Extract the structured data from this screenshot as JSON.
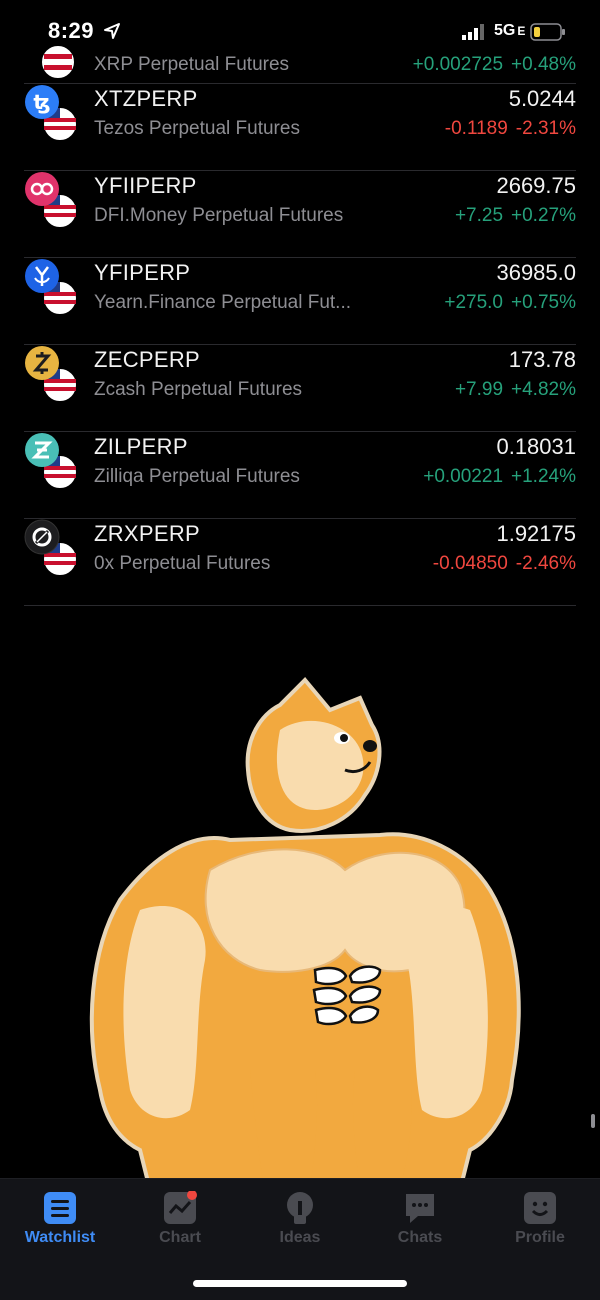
{
  "status_bar": {
    "time": "8:29",
    "network": "5G",
    "network_suffix": "E"
  },
  "rows": [
    {
      "symbol": "",
      "name": "XRP Perpetual Futures",
      "price": "",
      "change": "+0.002725",
      "change_pct": "+0.48%",
      "direction": "up",
      "icon": "xrp-coin-icon",
      "icon_color": "#3b6ee0"
    },
    {
      "symbol": "XTZPERP",
      "name": "Tezos Perpetual Futures",
      "price": "5.0244",
      "change": "-0.1189",
      "change_pct": "-2.31%",
      "direction": "down",
      "icon": "tezos-icon",
      "icon_color": "#2c7df7"
    },
    {
      "symbol": "YFIIPERP",
      "name": "DFI.Money Perpetual Futures",
      "price": "2669.75",
      "change": "+7.25",
      "change_pct": "+0.27%",
      "direction": "up",
      "icon": "dfi-money-icon",
      "icon_color": "#e0336b"
    },
    {
      "symbol": "YFIPERP",
      "name": "Yearn.Finance Perpetual Fut...",
      "price": "36985.0",
      "change": "+275.0",
      "change_pct": "+0.75%",
      "direction": "up",
      "icon": "yearn-finance-icon",
      "icon_color": "#1e63e6"
    },
    {
      "symbol": "ZECPERP",
      "name": "Zcash Perpetual Futures",
      "price": "173.78",
      "change": "+7.99",
      "change_pct": "+4.82%",
      "direction": "up",
      "icon": "zcash-icon",
      "icon_color": "#e7b441"
    },
    {
      "symbol": "ZILPERP",
      "name": "Zilliqa Perpetual Futures",
      "price": "0.18031",
      "change": "+0.00221",
      "change_pct": "+1.24%",
      "direction": "up",
      "icon": "zilliqa-icon",
      "icon_color": "#49bfb6"
    },
    {
      "symbol": "ZRXPERP",
      "name": "0x Perpetual Futures",
      "price": "1.92175",
      "change": "-0.04850",
      "change_pct": "-2.46%",
      "direction": "down",
      "icon": "0x-icon",
      "icon_color": "#1d1d1f"
    }
  ],
  "tabs": [
    {
      "label": "Watchlist",
      "icon": "watchlist-icon",
      "active": true
    },
    {
      "label": "Chart",
      "icon": "chart-icon",
      "active": false,
      "badge": true
    },
    {
      "label": "Ideas",
      "icon": "ideas-icon",
      "active": false
    },
    {
      "label": "Chats",
      "icon": "chats-icon",
      "active": false
    },
    {
      "label": "Profile",
      "icon": "profile-icon",
      "active": false
    }
  ],
  "colors": {
    "up": "#26a17b",
    "down": "#f0473f",
    "active_tab": "#3f8cf5",
    "inactive_tab": "#4a4b51",
    "background": "#000000"
  }
}
